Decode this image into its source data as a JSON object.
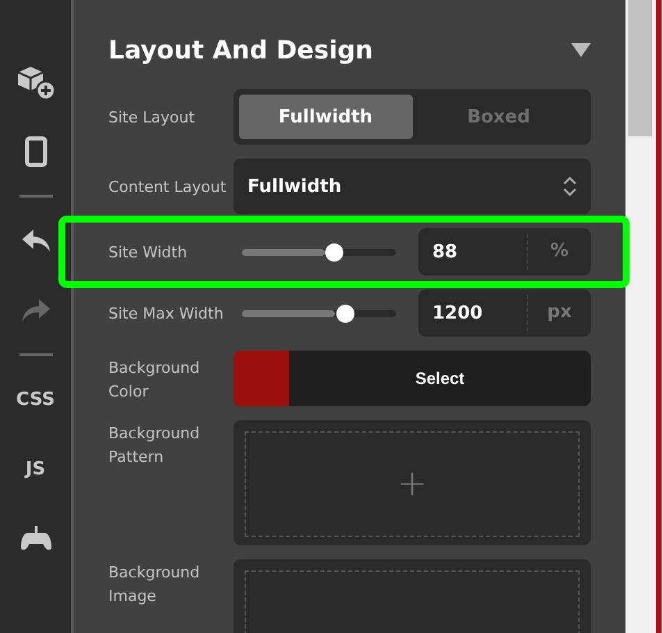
{
  "toolbar": {
    "items": [
      {
        "kind": "icon",
        "disabled": false
      },
      {
        "kind": "icon",
        "disabled": false
      },
      {
        "kind": "divider"
      },
      {
        "kind": "icon",
        "disabled": false
      },
      {
        "kind": "icon",
        "disabled": true
      },
      {
        "kind": "divider"
      },
      {
        "kind": "text",
        "label": "CSS",
        "disabled": false
      },
      {
        "kind": "text",
        "label": "JS",
        "disabled": false
      },
      {
        "kind": "icon",
        "disabled": false
      }
    ]
  },
  "panel": {
    "title": "Layout And Design",
    "expanded": true,
    "rows": [
      {
        "kind": "segmented",
        "label": "Site Layout",
        "highlighted": false,
        "options": [
          {
            "label": "Fullwidth",
            "selected": true
          },
          {
            "label": "Boxed",
            "selected": false
          }
        ]
      },
      {
        "kind": "select",
        "label": "Content Layout",
        "highlighted": false,
        "value": "Fullwidth"
      },
      {
        "kind": "slider",
        "label": "Site Width",
        "highlighted": true,
        "level": 0.6,
        "value": "88",
        "unit": "%"
      },
      {
        "kind": "slider",
        "label": "Site Max Width",
        "highlighted": false,
        "level": 0.67,
        "value": "1200",
        "unit": "px"
      },
      {
        "kind": "color",
        "label": "Background Color",
        "highlighted": false,
        "color": "#9b0e0e",
        "button": "Select"
      },
      {
        "kind": "upload",
        "label": "Background Pattern",
        "highlighted": false,
        "symbol": "+"
      },
      {
        "kind": "upload",
        "label": "Background Image",
        "highlighted": false
      }
    ]
  }
}
